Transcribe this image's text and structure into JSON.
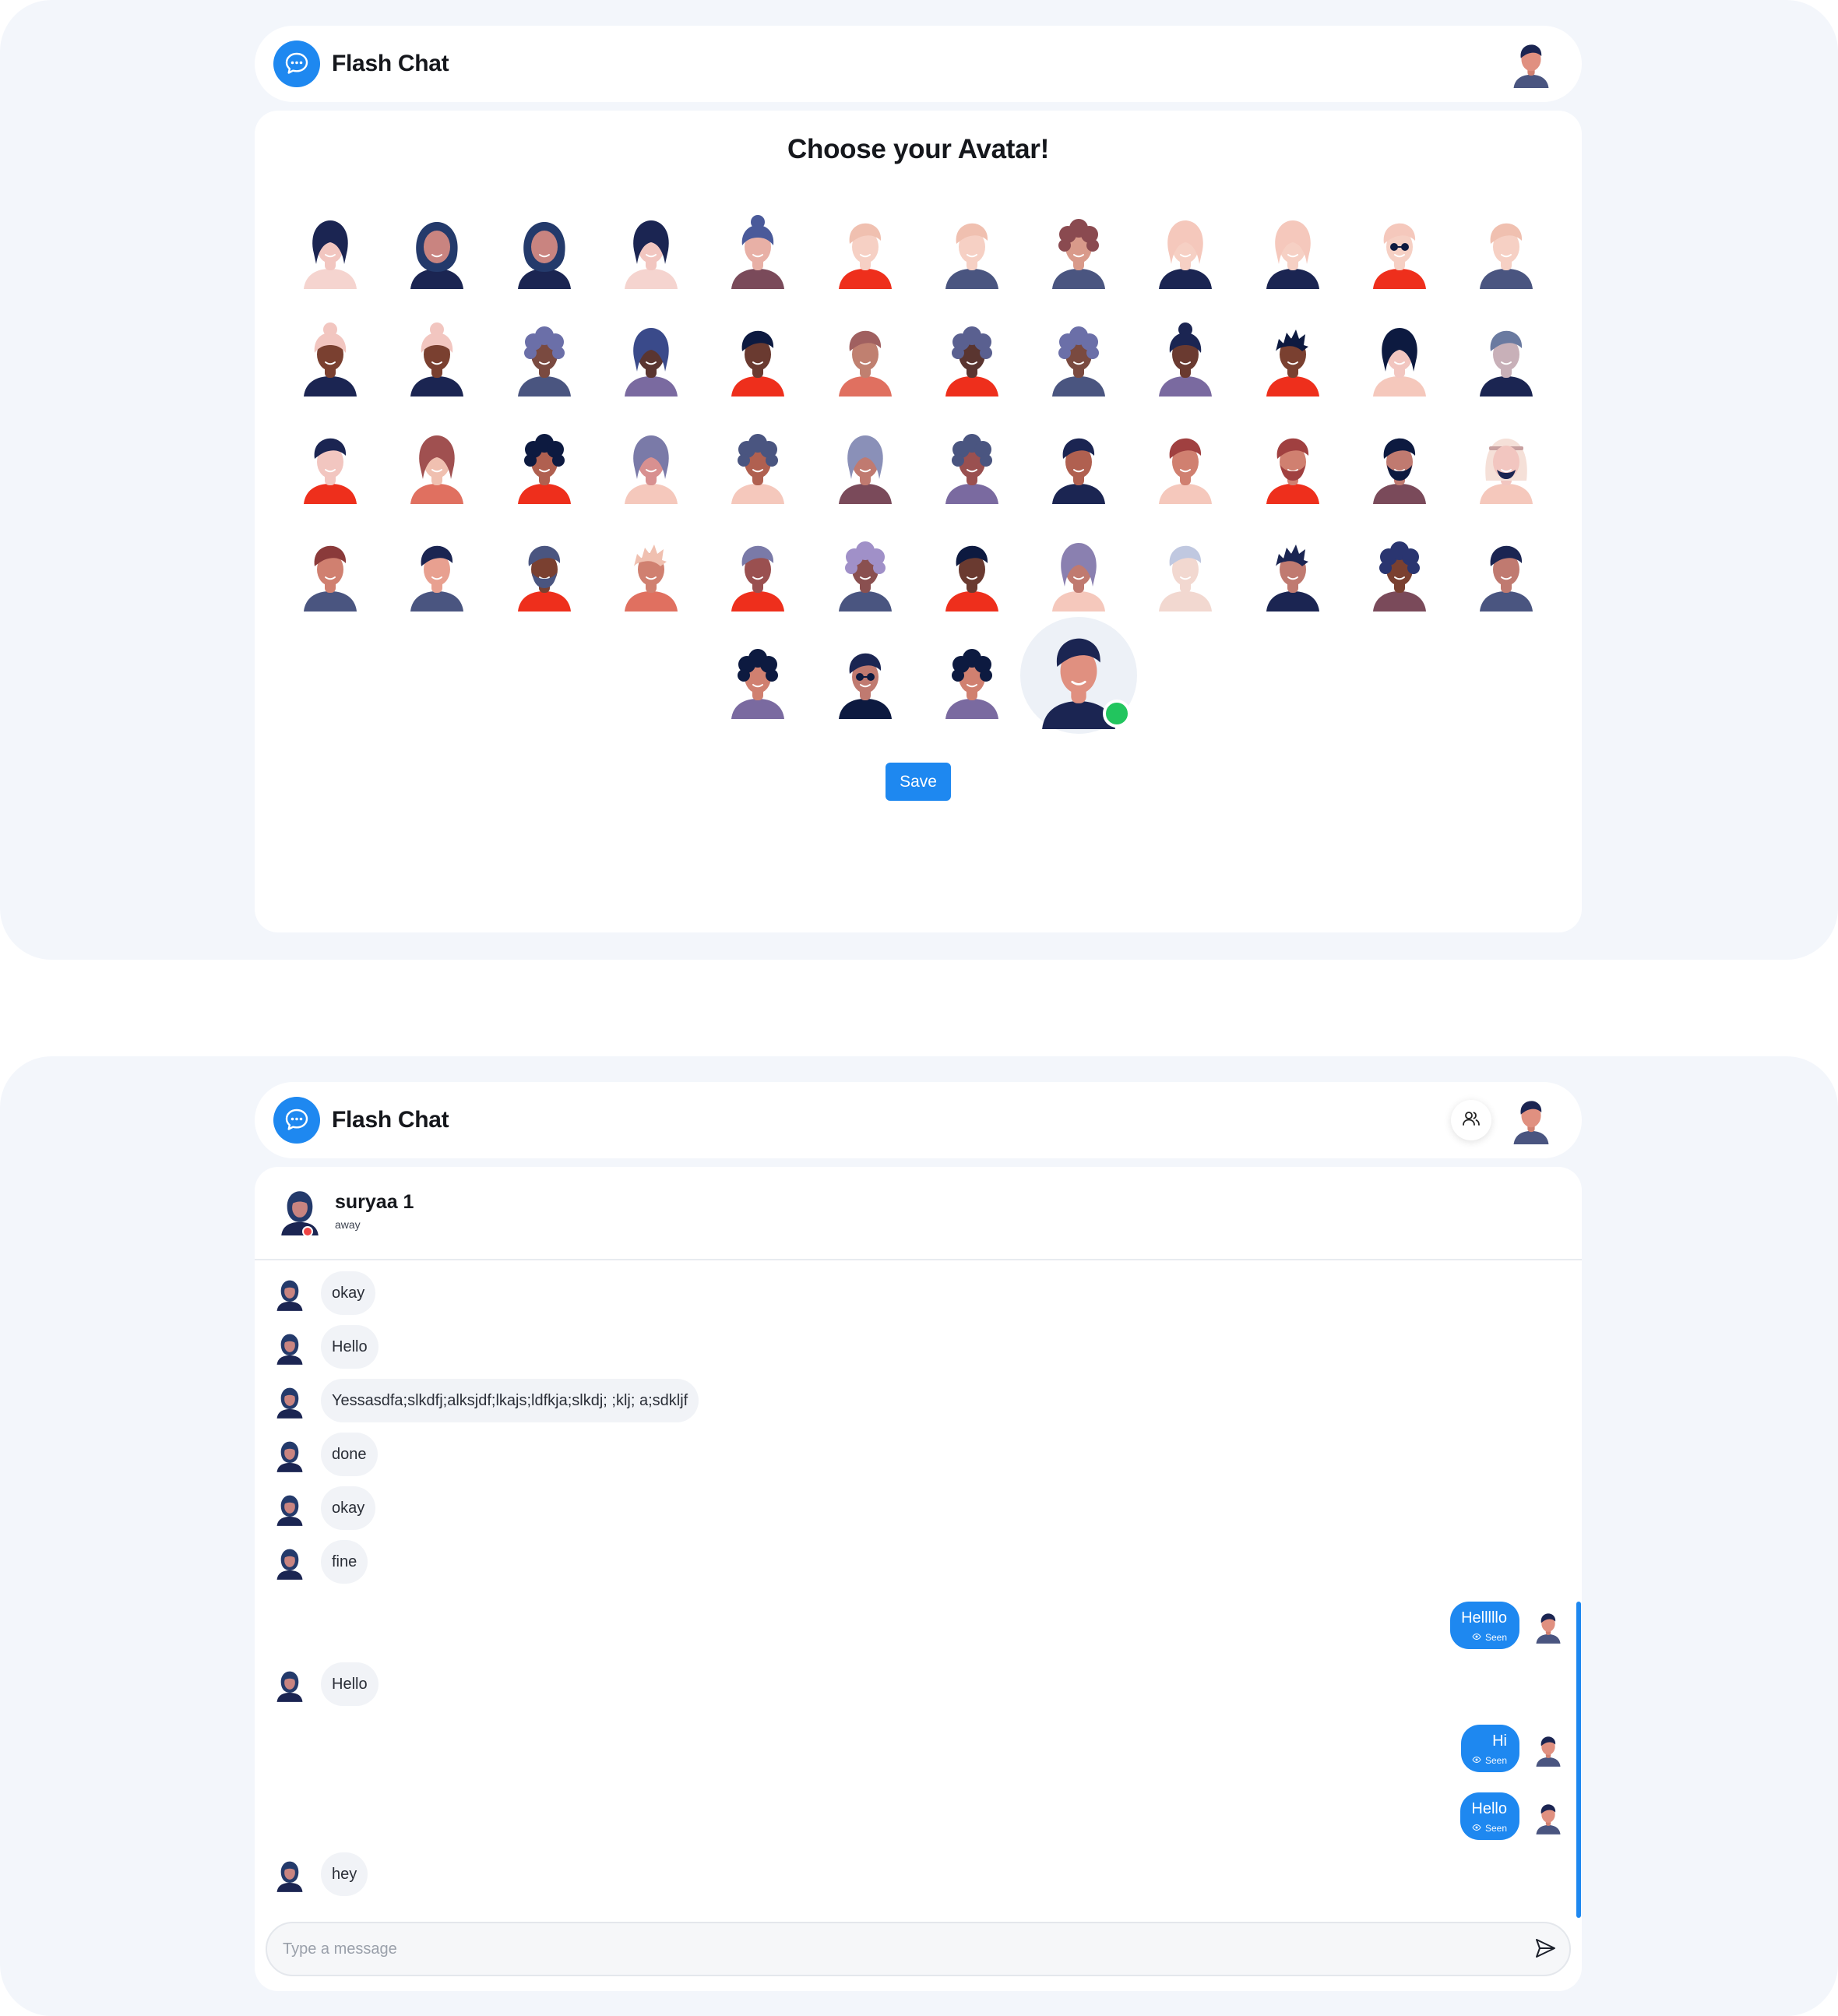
{
  "app": {
    "name": "Flash Chat"
  },
  "avatar_page": {
    "title": "Choose your Avatar!",
    "save_label": "Save",
    "selected_index": 51,
    "rows": [
      [
        {
          "skin": "#f2c6c0",
          "hair": "#1b2552",
          "shirt": "#f5d4cf",
          "style": "long"
        },
        {
          "skin": "#c98480",
          "hair": "#243a6b",
          "shirt": "#1b2552",
          "style": "hijab"
        },
        {
          "skin": "#c98480",
          "hair": "#243a6b",
          "shirt": "#1b2552",
          "style": "hijab"
        },
        {
          "skin": "#f2c6c0",
          "hair": "#1b2552",
          "shirt": "#f5d4cf",
          "style": "long"
        },
        {
          "skin": "#e8b0a6",
          "hair": "#4a5a9a",
          "shirt": "#7a4a5a",
          "style": "bun"
        },
        {
          "skin": "#f6d0c4",
          "hair": "#f0c0b0",
          "shirt": "#ee2f1c",
          "style": "short"
        },
        {
          "skin": "#f6d0c4",
          "hair": "#f0c0b0",
          "shirt": "#4a5580",
          "style": "short"
        },
        {
          "skin": "#d99a8a",
          "hair": "#8a4a50",
          "shirt": "#4a5580",
          "style": "curly"
        },
        {
          "skin": "#f6d0c4",
          "hair": "#f5c8bc",
          "shirt": "#1b2552",
          "style": "long"
        },
        {
          "skin": "#f6d0c4",
          "hair": "#f5c8bc",
          "shirt": "#1b2552",
          "style": "long"
        },
        {
          "skin": "#f6d0c4",
          "hair": "#f5c8bc",
          "shirt": "#ee2f1c",
          "style": "glasses"
        },
        {
          "skin": "#f6d0c4",
          "hair": "#f0c0b0",
          "shirt": "#4a5580",
          "style": "short"
        }
      ],
      [
        {
          "skin": "#7a4030",
          "hair": "#f2c6c0",
          "shirt": "#1b2552",
          "style": "bun"
        },
        {
          "skin": "#7a4030",
          "hair": "#f2c6c0",
          "shirt": "#1b2552",
          "style": "bun"
        },
        {
          "skin": "#7a4a40",
          "hair": "#6b6fa8",
          "shirt": "#4a5580",
          "style": "curly"
        },
        {
          "skin": "#5a3530",
          "hair": "#3a4a8a",
          "shirt": "#7a6aa0",
          "style": "long"
        },
        {
          "skin": "#6a3a30",
          "hair": "#0d1a40",
          "shirt": "#ee2f1c",
          "style": "short"
        },
        {
          "skin": "#c08070",
          "hair": "#a06060",
          "shirt": "#e07060",
          "style": "short"
        },
        {
          "skin": "#5a3530",
          "hair": "#5a6090",
          "shirt": "#ee2f1c",
          "style": "curly"
        },
        {
          "skin": "#7a4a40",
          "hair": "#6b6fa8",
          "shirt": "#4a5580",
          "style": "curly"
        },
        {
          "skin": "#6a3a30",
          "hair": "#1b2552",
          "shirt": "#7a6aa0",
          "style": "bun"
        },
        {
          "skin": "#7a4030",
          "hair": "#0d1a40",
          "shirt": "#ee2f1c",
          "style": "spiky"
        },
        {
          "skin": "#f2c6c0",
          "hair": "#0d1a40",
          "shirt": "#f5c8bc",
          "style": "long"
        },
        {
          "skin": "#c8b0b8",
          "hair": "#6a7aa0",
          "shirt": "#1b2552",
          "style": "short"
        }
      ],
      [
        {
          "skin": "#f2c6c0",
          "hair": "#1b2552",
          "shirt": "#ee2f1c",
          "style": "short"
        },
        {
          "skin": "#f0c0b0",
          "hair": "#a05050",
          "shirt": "#e07060",
          "style": "long"
        },
        {
          "skin": "#b06050",
          "hair": "#0d1a40",
          "shirt": "#ee2f1c",
          "style": "curly"
        },
        {
          "skin": "#d89090",
          "hair": "#7a7aa8",
          "shirt": "#f5c8bc",
          "style": "long"
        },
        {
          "skin": "#b06050",
          "hair": "#4a5580",
          "shirt": "#f5c8bc",
          "style": "curly"
        },
        {
          "skin": "#c07a70",
          "hair": "#8a90b8",
          "shirt": "#7a4a5a",
          "style": "long"
        },
        {
          "skin": "#9a5050",
          "hair": "#4a5580",
          "shirt": "#7a6aa0",
          "style": "curly"
        },
        {
          "skin": "#b06050",
          "hair": "#1b2552",
          "shirt": "#1b2552",
          "style": "short"
        },
        {
          "skin": "#d08070",
          "hair": "#a04040",
          "shirt": "#f5c8bc",
          "style": "short"
        },
        {
          "skin": "#d08070",
          "hair": "#a04040",
          "shirt": "#ee2f1c",
          "style": "beard"
        },
        {
          "skin": "#c07a70",
          "hair": "#0d1a40",
          "shirt": "#7a4a5a",
          "style": "beard"
        },
        {
          "skin": "#f2c6c0",
          "hair": "#f5e0d8",
          "shirt": "#f5c8bc",
          "style": "headdress"
        }
      ],
      [
        {
          "skin": "#d08070",
          "hair": "#8a3a3a",
          "shirt": "#4a5580",
          "style": "short"
        },
        {
          "skin": "#e8a090",
          "hair": "#1b2552",
          "shirt": "#4a5580",
          "style": "short"
        },
        {
          "skin": "#7a4030",
          "hair": "#4a5580",
          "shirt": "#ee2f1c",
          "style": "beard"
        },
        {
          "skin": "#d08070",
          "hair": "#f0c0b0",
          "shirt": "#e07060",
          "style": "spiky"
        },
        {
          "skin": "#9a5050",
          "hair": "#7a7aa8",
          "shirt": "#ee2f1c",
          "style": "short"
        },
        {
          "skin": "#8a5050",
          "hair": "#a090c8",
          "shirt": "#4a5580",
          "style": "curly"
        },
        {
          "skin": "#6a3a30",
          "hair": "#0d1a40",
          "shirt": "#ee2f1c",
          "style": "short"
        },
        {
          "skin": "#c07a70",
          "hair": "#8a80b0",
          "shirt": "#f5c8bc",
          "style": "long"
        },
        {
          "skin": "#f2d8d0",
          "hair": "#c0c8e0",
          "shirt": "#f2d8d0",
          "style": "short"
        },
        {
          "skin": "#c07a70",
          "hair": "#1b2552",
          "shirt": "#1b2552",
          "style": "spiky"
        },
        {
          "skin": "#7a4030",
          "hair": "#2a3570",
          "shirt": "#7a4a5a",
          "style": "curly"
        },
        {
          "skin": "#c07a70",
          "hair": "#1b2552",
          "shirt": "#4a5580",
          "style": "short"
        }
      ],
      [
        {
          "skin": "#d08070",
          "hair": "#0d1a40",
          "shirt": "#7a6aa0",
          "style": "curly"
        },
        {
          "skin": "#c07a70",
          "hair": "#1b2552",
          "shirt": "#0d1a40",
          "style": "glasses"
        },
        {
          "skin": "#d08070",
          "hair": "#0d1a40",
          "shirt": "#7a6aa0",
          "style": "curly"
        },
        {
          "skin": "#e09080",
          "hair": "#1b2552",
          "shirt": "#1b2552",
          "style": "short"
        }
      ]
    ]
  },
  "chat_page": {
    "peer": {
      "name": "suryaa 1",
      "status": "away"
    },
    "composer_placeholder": "Type a message",
    "messages": [
      {
        "dir": "in",
        "text": "okay"
      },
      {
        "dir": "in",
        "text": "Hello"
      },
      {
        "dir": "in",
        "text": "Yessasdfa;slkdfj;alksjdf;lkajs;ldfkja;slkdj; ;klj; a;sdkljf"
      },
      {
        "dir": "in",
        "text": "done"
      },
      {
        "dir": "in",
        "text": "okay"
      },
      {
        "dir": "in",
        "text": "fine"
      },
      {
        "dir": "out",
        "text": "Helllllo",
        "meta": "Seen"
      },
      {
        "dir": "in",
        "text": "Hello"
      },
      {
        "dir": "out",
        "text": "Hi",
        "meta": "Seen"
      },
      {
        "dir": "out",
        "text": "Hello",
        "meta": "Seen"
      },
      {
        "dir": "in",
        "text": "hey"
      }
    ]
  },
  "icons": {
    "logo": "chat-bubble-icon",
    "people": "users-icon",
    "send": "send-icon",
    "seen": "eye-icon",
    "selected": "check-icon"
  },
  "colors": {
    "accent": "#1e88f0",
    "success": "#22c55e",
    "away": "#ef4444",
    "panel_bg": "#f3f6fb"
  }
}
